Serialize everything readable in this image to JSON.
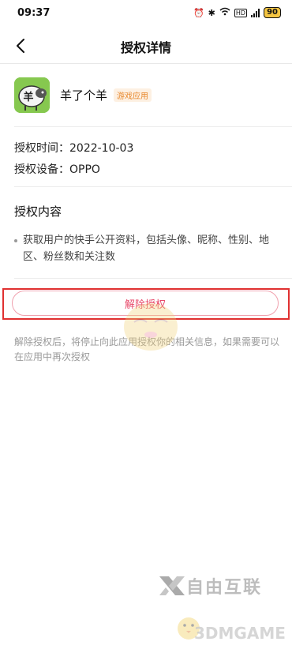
{
  "status_bar": {
    "time": "09:37",
    "battery": "90",
    "network_badge": "HD"
  },
  "header": {
    "title": "授权详情"
  },
  "app": {
    "name": "羊了个羊",
    "tag": "游戏应用",
    "icon_glyph": "羊"
  },
  "details": {
    "time_label": "授权时间：",
    "time_value": "2022-10-03",
    "device_label": "授权设备：",
    "device_value": "OPPO"
  },
  "content": {
    "title": "授权内容",
    "items": [
      "获取用户的快手公开资料，包括头像、昵称、性别、地区、粉丝数和关注数"
    ]
  },
  "actions": {
    "revoke_label": "解除授权",
    "revoke_note": "解除授权后，将停止向此应用授权你的相关信息，如果需要可以在应用中再次授权"
  },
  "watermark": {
    "brand": "自由互联",
    "site": "3DMGAME"
  },
  "colors": {
    "accent_pink": "#e8496a",
    "highlight_red": "#e03030",
    "tag_orange": "#e8892f"
  }
}
